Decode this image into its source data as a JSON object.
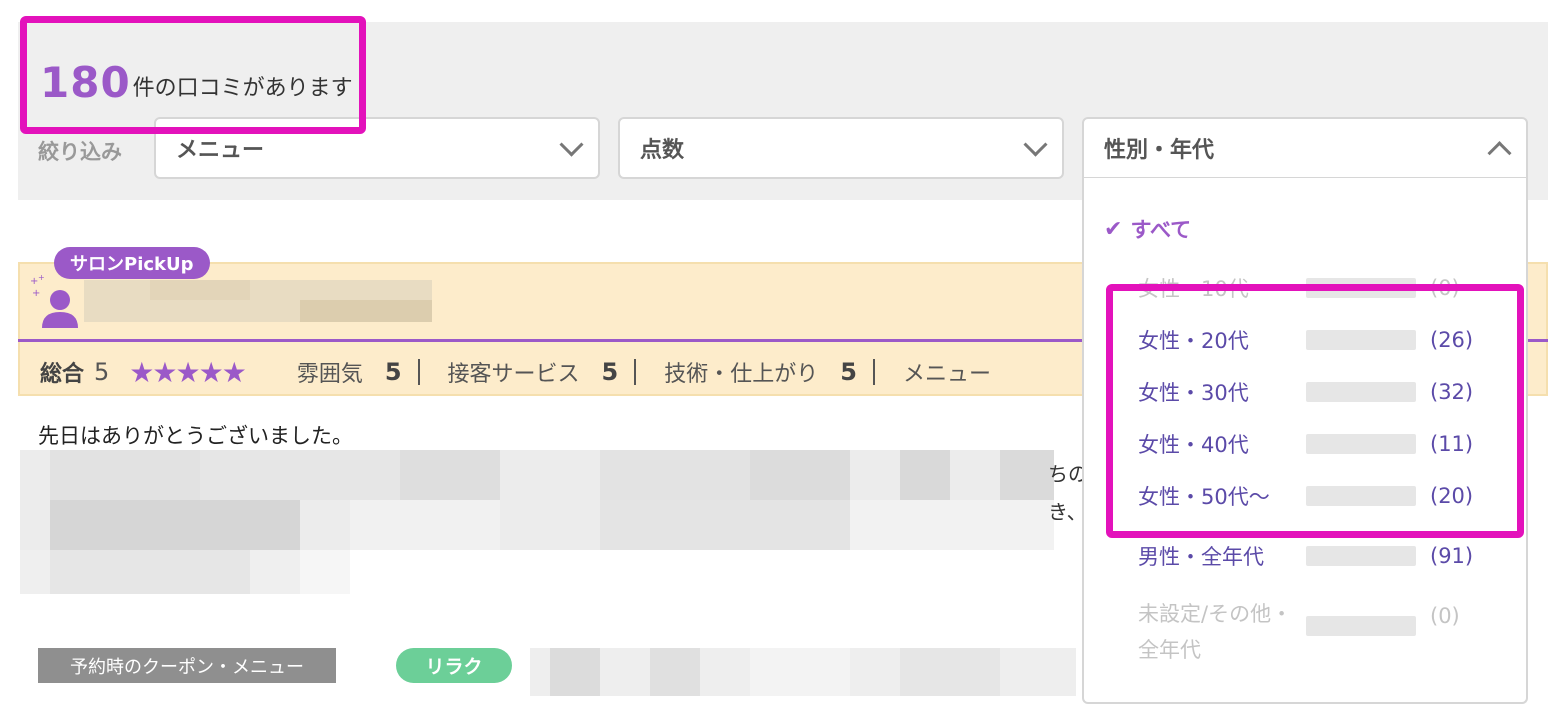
{
  "review_count": {
    "number": "180",
    "suffix": "件の口コミがあります"
  },
  "filters": {
    "label": "絞り込み",
    "menu": "メニュー",
    "score": "点数",
    "gender_age": "性別・年代"
  },
  "dropdown": {
    "selected": "すべて",
    "options": [
      {
        "label": "女性・10代",
        "count": "(0)",
        "ratio": 0.0,
        "state": "disabled"
      },
      {
        "label": "女性・20代",
        "count": "(26)",
        "ratio": 0.28
      },
      {
        "label": "女性・30代",
        "count": "(32)",
        "ratio": 0.35
      },
      {
        "label": "女性・40代",
        "count": "(11)",
        "ratio": 0.12
      },
      {
        "label": "女性・50代〜",
        "count": "(20)",
        "ratio": 0.22
      },
      {
        "label": "男性・全年代",
        "count": "(91)",
        "ratio": 1.0
      },
      {
        "label_line1": "未設定/その他・",
        "label_line2": "全年代",
        "count": "(0)",
        "ratio": 0.0,
        "state": "disabled"
      }
    ]
  },
  "review": {
    "badge": "サロンPickUp",
    "total_label": "総合",
    "total_score": "5",
    "stars": "★★★★★",
    "sub_scores": [
      {
        "label": "雰囲気",
        "value": "5"
      },
      {
        "label": "接客サービス",
        "value": "5"
      },
      {
        "label": "技術・仕上がり",
        "value": "5"
      },
      {
        "label": "メニュー",
        "value": ""
      }
    ],
    "text_first_line": "先日はありがとうございました。",
    "fragment_1": "ちの",
    "fragment_2": "き、",
    "coupon_label": "予約時のクーポン・メニュー",
    "category_tag": "リラク"
  },
  "colors": {
    "accent": "#9b59c8",
    "highlight": "#e312bb",
    "pickup_bg": "#fdeccb",
    "relax_tag": "#6ccf98"
  }
}
